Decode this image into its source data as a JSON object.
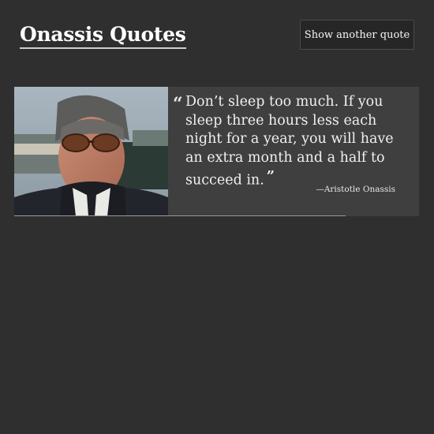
{
  "header": {
    "title": "Onassis Quotes",
    "next_button_label": "Show another quote"
  },
  "quote": {
    "open_mark": "“",
    "text": "Don’t sleep too much. If you sleep three hours less each night for a year, you will have an extra month and a half to succeed in.",
    "close_mark": "”",
    "attribution": "—Aristotle Onassis"
  },
  "colors": {
    "background": "#2f2f2f",
    "card": "#3f3f3f",
    "button": "#262626",
    "text": "#f0f0f0"
  }
}
